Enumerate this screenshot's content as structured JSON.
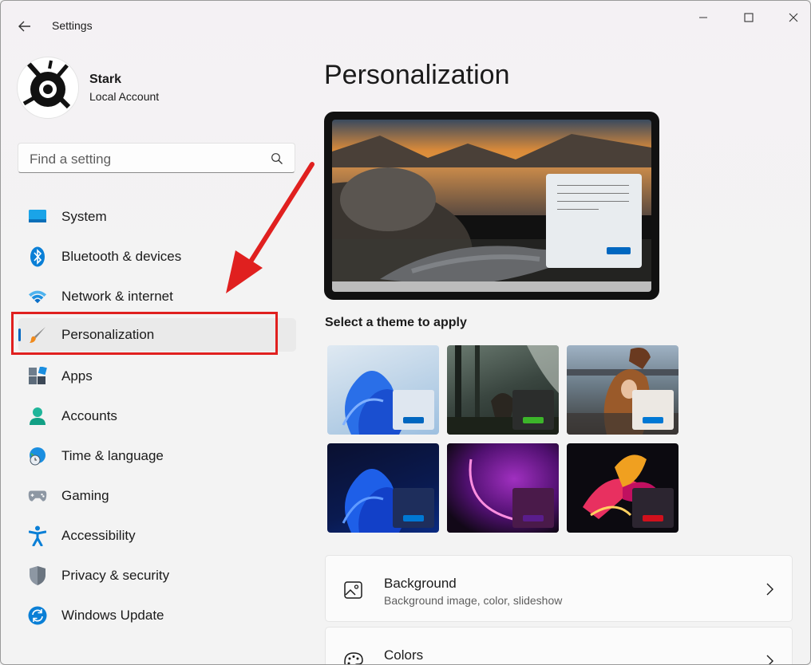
{
  "window": {
    "title": "Settings"
  },
  "profile": {
    "name": "Stark",
    "account_type": "Local Account"
  },
  "search": {
    "placeholder": "Find a setting"
  },
  "sidebar": {
    "items": [
      {
        "label": "System",
        "icon": "system-icon"
      },
      {
        "label": "Bluetooth & devices",
        "icon": "bluetooth-icon"
      },
      {
        "label": "Network & internet",
        "icon": "wifi-icon"
      },
      {
        "label": "Personalization",
        "icon": "paintbrush-icon",
        "active": true
      },
      {
        "label": "Apps",
        "icon": "apps-icon"
      },
      {
        "label": "Accounts",
        "icon": "person-icon"
      },
      {
        "label": "Time & language",
        "icon": "globe-clock-icon"
      },
      {
        "label": "Gaming",
        "icon": "gamepad-icon"
      },
      {
        "label": "Accessibility",
        "icon": "accessibility-icon"
      },
      {
        "label": "Privacy & security",
        "icon": "shield-icon"
      },
      {
        "label": "Windows Update",
        "icon": "refresh-icon"
      }
    ]
  },
  "main": {
    "title": "Personalization",
    "theme_section_label": "Select a theme to apply",
    "themes": [
      {
        "style": "light-bloom",
        "window_color": "#dfe7f0",
        "accent": "#0067c0"
      },
      {
        "style": "dark-forest",
        "window_color": "#2b2d2c",
        "accent": "#3cb52a"
      },
      {
        "style": "autumn-portrait",
        "window_color": "#ece8e3",
        "accent": "#0078d4"
      },
      {
        "style": "dark-bloom",
        "window_color": "#1e2e5c",
        "accent": "#0078d4"
      },
      {
        "style": "glow",
        "window_color": "#4a1a4a",
        "accent": "#5a1d8c"
      },
      {
        "style": "captured-motion",
        "window_color": "#2c2530",
        "accent": "#d1101c"
      }
    ],
    "cards": [
      {
        "title": "Background",
        "subtitle": "Background image, color, slideshow",
        "icon": "image-icon"
      },
      {
        "title": "Colors",
        "subtitle": "",
        "icon": "palette-icon"
      }
    ]
  },
  "colors": {
    "accent": "#0067c0",
    "annotation_red": "#e0201f"
  }
}
